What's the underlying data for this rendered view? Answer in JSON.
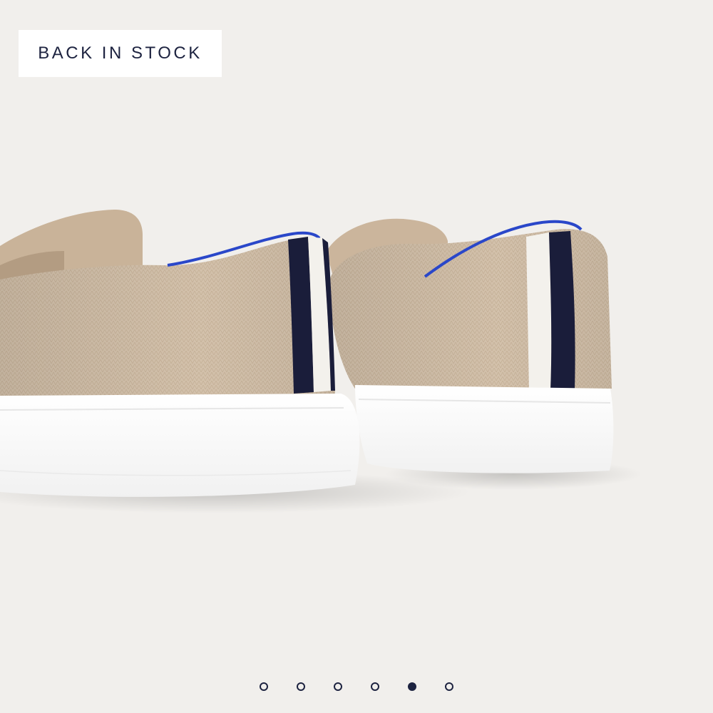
{
  "badge": {
    "label": "BACK IN STOCK"
  },
  "gallery": {
    "image": {
      "name": "product-photo-slip-on-shoes",
      "colors": {
        "knit": "#d2bfa9",
        "sole": "#ffffff",
        "navy_stripe": "#1a1d3a",
        "white_stripe": "#f3f1ec",
        "blue_trim": "#2a47c9",
        "background": "#f1efec"
      }
    },
    "pagination": {
      "total": 6,
      "active_index": 4
    }
  }
}
